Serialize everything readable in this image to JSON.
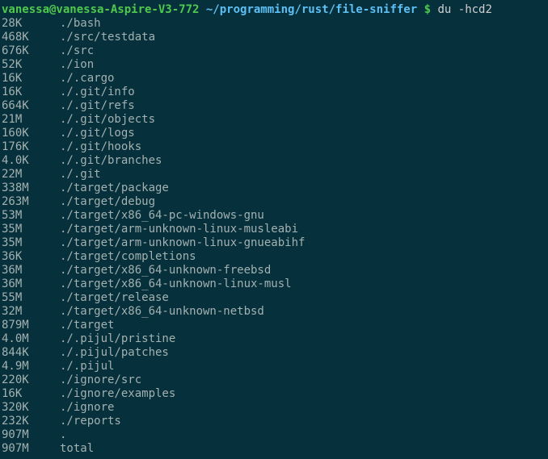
{
  "prompt": {
    "user_host": "vanessa@vanessa-Aspire-V3-772",
    "cwd": "~/programming/rust/file-sniffer",
    "dollar": "$",
    "command": "du -hcd2"
  },
  "rows": [
    {
      "size": "28K",
      "path": "./bash"
    },
    {
      "size": "468K",
      "path": "./src/testdata"
    },
    {
      "size": "676K",
      "path": "./src"
    },
    {
      "size": "52K",
      "path": "./ion"
    },
    {
      "size": "16K",
      "path": "./.cargo"
    },
    {
      "size": "16K",
      "path": "./.git/info"
    },
    {
      "size": "664K",
      "path": "./.git/refs"
    },
    {
      "size": "21M",
      "path": "./.git/objects"
    },
    {
      "size": "160K",
      "path": "./.git/logs"
    },
    {
      "size": "176K",
      "path": "./.git/hooks"
    },
    {
      "size": "4.0K",
      "path": "./.git/branches"
    },
    {
      "size": "22M",
      "path": "./.git"
    },
    {
      "size": "338M",
      "path": "./target/package"
    },
    {
      "size": "263M",
      "path": "./target/debug"
    },
    {
      "size": "53M",
      "path": "./target/x86_64-pc-windows-gnu"
    },
    {
      "size": "35M",
      "path": "./target/arm-unknown-linux-musleabi"
    },
    {
      "size": "35M",
      "path": "./target/arm-unknown-linux-gnueabihf"
    },
    {
      "size": "36K",
      "path": "./target/completions"
    },
    {
      "size": "36M",
      "path": "./target/x86_64-unknown-freebsd"
    },
    {
      "size": "36M",
      "path": "./target/x86_64-unknown-linux-musl"
    },
    {
      "size": "55M",
      "path": "./target/release"
    },
    {
      "size": "32M",
      "path": "./target/x86_64-unknown-netbsd"
    },
    {
      "size": "879M",
      "path": "./target"
    },
    {
      "size": "4.0M",
      "path": "./.pijul/pristine"
    },
    {
      "size": "844K",
      "path": "./.pijul/patches"
    },
    {
      "size": "4.9M",
      "path": "./.pijul"
    },
    {
      "size": "220K",
      "path": "./ignore/src"
    },
    {
      "size": "16K",
      "path": "./ignore/examples"
    },
    {
      "size": "320K",
      "path": "./ignore"
    },
    {
      "size": "232K",
      "path": "./reports"
    },
    {
      "size": "907M",
      "path": "."
    },
    {
      "size": "907M",
      "path": "total"
    }
  ]
}
